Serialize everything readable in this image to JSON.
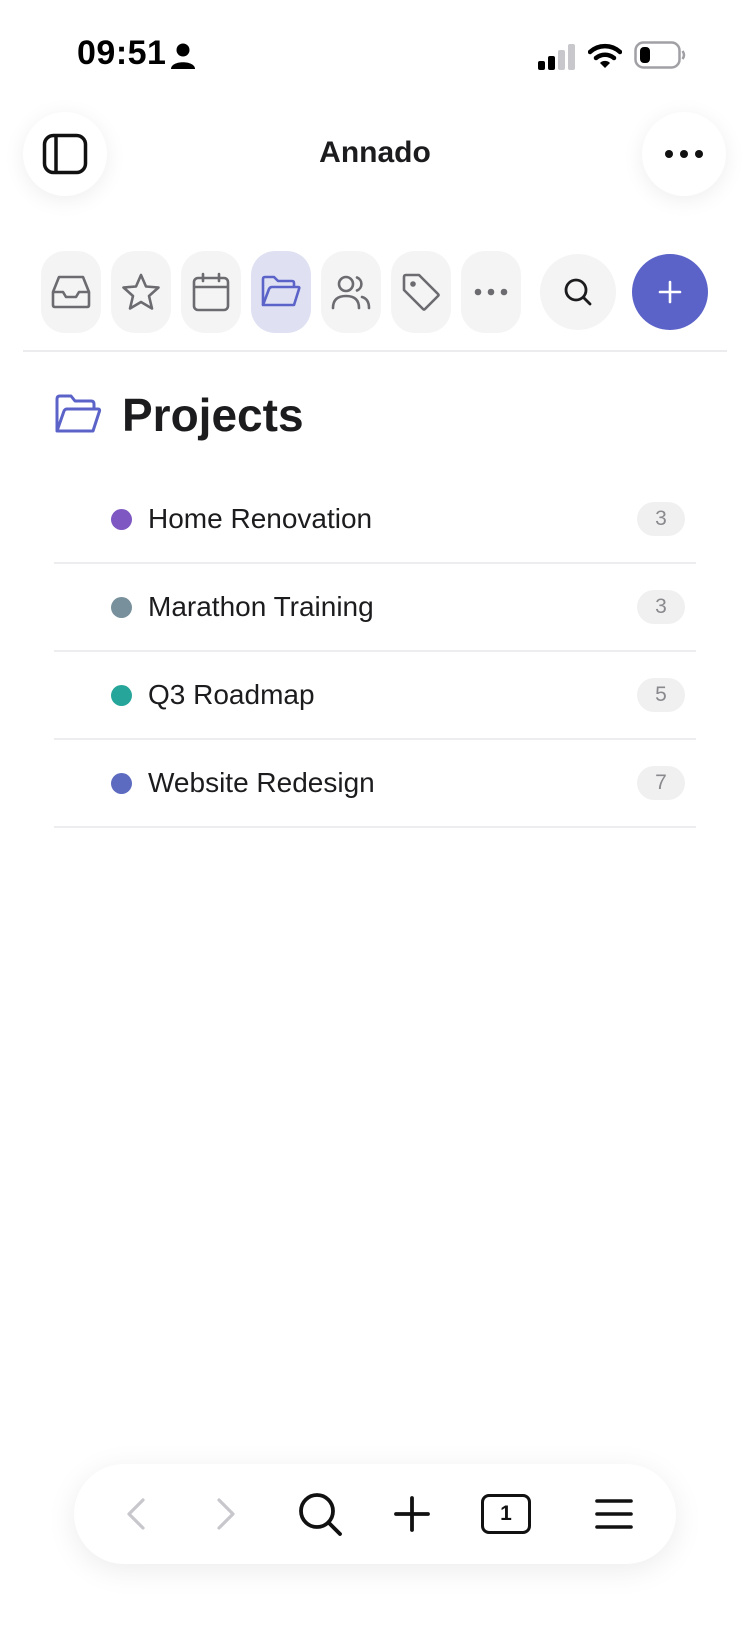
{
  "status_bar": {
    "time": "09:51",
    "icons": [
      "person-icon",
      "signal-icon",
      "wifi-icon",
      "battery-icon"
    ]
  },
  "header": {
    "title": "Annado",
    "left_button_icon": "sidebar-toggle-icon",
    "right_button_icon": "more-horizontal-icon"
  },
  "nav_tabs": [
    {
      "icon": "inbox-icon",
      "active": false
    },
    {
      "icon": "star-icon",
      "active": false
    },
    {
      "icon": "calendar-icon",
      "active": false
    },
    {
      "icon": "folder-open-icon",
      "active": true
    },
    {
      "icon": "people-icon",
      "active": false
    },
    {
      "icon": "tag-icon",
      "active": false
    },
    {
      "icon": "more-horizontal-icon",
      "active": false
    }
  ],
  "search_icon": "search-icon",
  "add_icon": "plus-icon",
  "section": {
    "title": "Projects",
    "icon": "folder-open-icon"
  },
  "projects": [
    {
      "name": "Home Renovation",
      "count": "3",
      "color": "#7e57c2"
    },
    {
      "name": "Marathon Training",
      "count": "3",
      "color": "#78909c"
    },
    {
      "name": "Q3 Roadmap",
      "count": "5",
      "color": "#26a69a"
    },
    {
      "name": "Website Redesign",
      "count": "7",
      "color": "#5c6bc0"
    }
  ],
  "bottom_toolbar": {
    "tab_count": "1",
    "icons": [
      "back-icon",
      "forward-icon",
      "search-icon",
      "new-tab-icon",
      "tabs-icon",
      "menu-icon"
    ]
  },
  "colors": {
    "accent": "#5b63c8",
    "active_tab_bg": "#dfe1f3",
    "tab_bg": "#f4f4f5"
  }
}
